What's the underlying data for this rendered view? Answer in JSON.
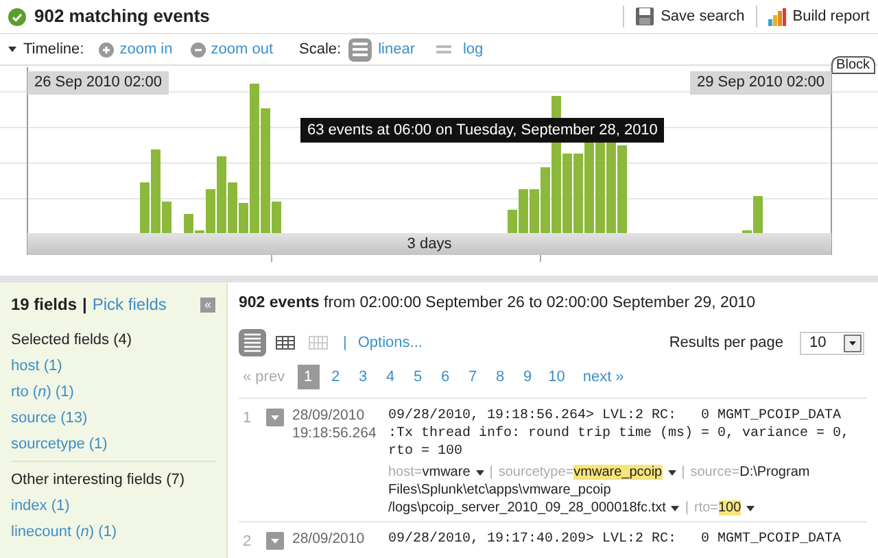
{
  "header": {
    "title": "902 matching events",
    "actions": [
      {
        "kind": "save",
        "label": "Save search"
      },
      {
        "kind": "report",
        "label": "Build report"
      }
    ]
  },
  "timeline": {
    "label": "Timeline:",
    "zoom": [
      {
        "kind": "in",
        "label": "zoom in"
      },
      {
        "kind": "out",
        "label": "zoom out"
      }
    ],
    "scale_label": "Scale:",
    "scales": [
      {
        "kind": "linear",
        "label": "linear",
        "selected": true
      },
      {
        "kind": "log",
        "label": "log",
        "selected": false
      }
    ],
    "block_label": "Block",
    "start_label": "26 Sep 2010 02:00",
    "end_label": "29 Sep 2010 02:00",
    "span_label": "3 days",
    "tooltip": "63 events at 06:00 on Tuesday, September 28, 2010"
  },
  "sidebar": {
    "count": "19 fields",
    "separator": "|",
    "pick": "Pick fields",
    "collapse": "«",
    "groups": [
      {
        "title": "Selected fields (4)",
        "fields": [
          "host (1)",
          "rto (*n*) (1)",
          "source (13)",
          "sourcetype (1)"
        ]
      },
      {
        "title": "Other interesting fields (7)",
        "fields": [
          "index (1)",
          "linecount (*n*) (1)"
        ]
      }
    ]
  },
  "results": {
    "summary": "**902 events** from 02:00:00 September 26 to 02:00:00 September 29, 2010",
    "views": [
      {
        "kind": "list",
        "selected": true
      },
      {
        "kind": "table",
        "selected": false
      },
      {
        "kind": "grid",
        "selected": false
      }
    ],
    "options_separator": "|",
    "options": "Options...",
    "per_page_label": "Results per page",
    "per_page": "10",
    "prev": "« prev",
    "next": "next »",
    "pages": [
      {
        "label": "1",
        "selected": true
      },
      {
        "label": "2",
        "selected": false
      },
      {
        "label": "3",
        "selected": false
      },
      {
        "label": "4",
        "selected": false
      },
      {
        "label": "5",
        "selected": false
      },
      {
        "label": "6",
        "selected": false
      },
      {
        "label": "7",
        "selected": false
      },
      {
        "label": "8",
        "selected": false
      },
      {
        "label": "9",
        "selected": false
      },
      {
        "label": "10",
        "selected": false
      }
    ],
    "events": [
      {
        "index": "1",
        "date": "28/09/2010",
        "time": "19:18:56.264",
        "raw": [
          "09/28/2010, 19:18:56.264> LVL:2 RC:   0 MGMT_PCOIP_DATA",
          ":Tx thread info: round trip time (ms) = 0, variance = 0,",
          "rto = 100"
        ],
        "field_separator": "|",
        "fields": [
          {
            "key": "host=",
            "value": [
              "vmware"
            ],
            "highlighted": false
          },
          {
            "key": "sourcetype=",
            "value": [
              "vmware_pcoip"
            ],
            "highlighted": true
          },
          {
            "key": "source=",
            "value": [
              "D:\\Program",
              "Files\\Splunk\\etc\\apps\\vmware_pcoip",
              "/logs\\pcoip_server_2010_09_28_000018fc.txt"
            ],
            "highlighted": false
          },
          {
            "key": "rto=",
            "value": [
              "100"
            ],
            "highlighted": true
          }
        ]
      },
      {
        "index": "2",
        "date": "28/09/2010",
        "raw": [
          "09/28/2010, 19:17:40.209> LVL:2 RC:   0 MGMT_PCOIP_DATA"
        ]
      }
    ]
  }
}
